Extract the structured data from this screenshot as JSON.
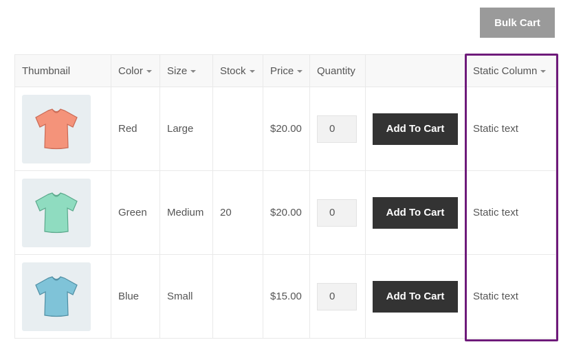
{
  "toolbar": {
    "bulk_cart_label": "Bulk Cart"
  },
  "table": {
    "headers": {
      "thumbnail": "Thumbnail",
      "color": "Color",
      "size": "Size",
      "stock": "Stock",
      "price": "Price",
      "quantity": "Quantity",
      "action": "",
      "static": "Static Column"
    },
    "rows": [
      {
        "thumb_icon": "tshirt-icon",
        "thumb_color": "#f4937a",
        "color": "Red",
        "size": "Large",
        "stock": "",
        "price": "$20.00",
        "quantity": "0",
        "button_label": "Add To Cart",
        "static_text": "Static text"
      },
      {
        "thumb_icon": "tshirt-icon",
        "thumb_color": "#8fdcc0",
        "color": "Green",
        "size": "Medium",
        "stock": "20",
        "price": "$20.00",
        "quantity": "0",
        "button_label": "Add To Cart",
        "static_text": "Static text"
      },
      {
        "thumb_icon": "tshirt-icon",
        "thumb_color": "#7fc3d8",
        "color": "Blue",
        "size": "Small",
        "stock": "",
        "price": "$15.00",
        "quantity": "0",
        "button_label": "Add To Cart",
        "static_text": "Static text"
      }
    ]
  },
  "colors": {
    "bulk_button_bg": "#9a9a9a",
    "add_button_bg": "#333333",
    "highlight_border": "#6e1a7a",
    "thumb_bg": "#e8eef1"
  }
}
